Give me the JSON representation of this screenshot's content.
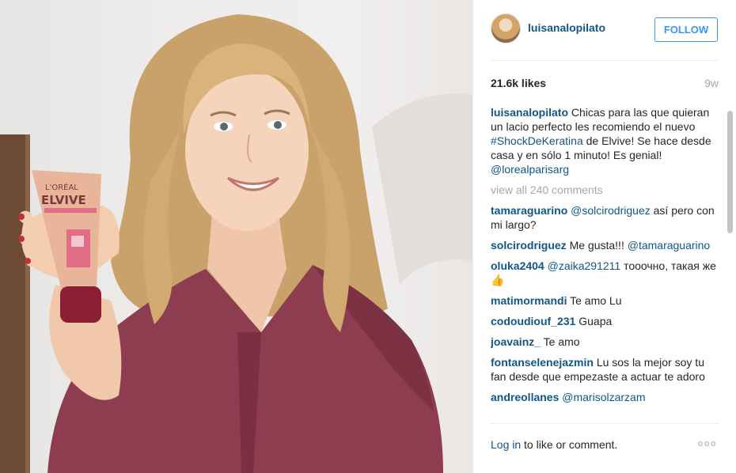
{
  "header": {
    "username": "luisanalopilato",
    "follow_label": "FOLLOW"
  },
  "stats": {
    "likes": "21.6k likes",
    "age": "9w"
  },
  "caption": {
    "user": "luisanalopilato",
    "text_1": "Chicas para las que quieran un lacio perfecto les recomiendo el nuevo",
    "hashtag": "#ShockDeKeratina",
    "text_2": "de Elvive! Se hace desde casa y en sólo 1 minuto! Es genial!",
    "mention": "@lorealparisarg"
  },
  "view_all": "view all 240 comments",
  "comments": [
    {
      "user": "tamaraguarino",
      "mention": "@solcirodriguez",
      "text": "así pero con mi largo?"
    },
    {
      "user": "solcirodriguez",
      "text": "Me gusta!!!",
      "mention": "@tamaraguarino"
    },
    {
      "user": "oluka2404",
      "mention": "@zaika291211",
      "text": "тооочно, такая же👍"
    },
    {
      "user": "matimormandi",
      "text": "Te amo Lu"
    },
    {
      "user": "codoudiouf_231",
      "text": "Guapa"
    },
    {
      "user": "joavainz_",
      "text": "Te amo"
    },
    {
      "user": "fontanselenejazmin",
      "text": "Lu sos la mejor soy tu fan desde que empezaste a actuar te adoro"
    },
    {
      "user": "andreollanes",
      "mention": "@marisolzarzam"
    }
  ],
  "footer": {
    "login": "Log in",
    "rest": "to like or comment.",
    "more": "ooo"
  },
  "product": {
    "brand": "L'ORÉAL",
    "name": "ELVIVE"
  },
  "colors": {
    "link": "#125688",
    "follow": "#3897f0",
    "muted": "#a5a7aa",
    "blouse": "#8e3c4f"
  }
}
